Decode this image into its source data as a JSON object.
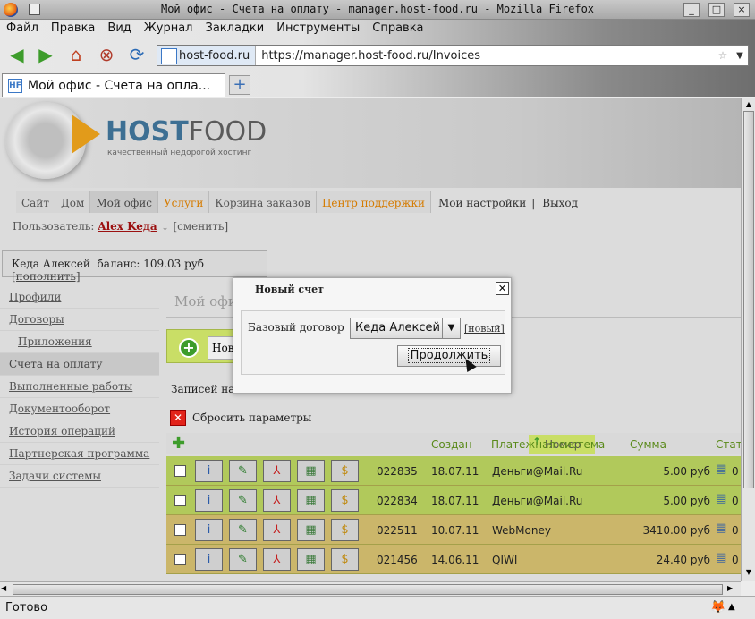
{
  "window": {
    "title": "Мой офис - Счета на оплату - manager.host-food.ru - Mozilla Firefox",
    "btn_min": "_",
    "btn_max": "□",
    "btn_close": "×"
  },
  "menu": [
    "Файл",
    "Правка",
    "Вид",
    "Журнал",
    "Закладки",
    "Инструменты",
    "Справка"
  ],
  "toolbar": {
    "back": "◀",
    "forward": "▶",
    "home": "⌂",
    "stop": "⊗",
    "reload": "⟳"
  },
  "address": {
    "site": "host-food.ru",
    "url": "https://manager.host-food.ru/Invoices",
    "star": "☆",
    "drop": "▼"
  },
  "tab": {
    "label": "Мой офис - Счета на опла...",
    "fav": "HF",
    "new": "+"
  },
  "site": {
    "logo_host": "HOST",
    "logo_food": "FOOD",
    "tagline": "качественный недорогой хостинг"
  },
  "nav": [
    "Сайт",
    "Дом",
    "Мой офис",
    "Услуги",
    "Корзина заказов",
    "Центр поддержки"
  ],
  "nav_plain": [
    "Мои настройки",
    "Выход"
  ],
  "nav_sep": "|",
  "user": {
    "prefix": "Пользователь:",
    "name": "Alex Keда",
    "arrow": "↓",
    "change": "[сменить]"
  },
  "balance": {
    "name": "Кеда Алексей",
    "text": "баланс: 109.03 руб",
    "link": "[пополнить]"
  },
  "sidebar": [
    "Профили",
    "Договоры",
    "Приложения",
    "Счета на оплату",
    "Выполненные работы",
    "Документооборот",
    "История операций",
    "Партнерская программа",
    "Задачи системы"
  ],
  "content": {
    "title": "Мой офис",
    "new_text": "Нов",
    "records": "Записей на",
    "reset": "Сбросить параметры",
    "reset_icon": "✕"
  },
  "table": {
    "plus": "✚",
    "dash": "-",
    "headers": [
      "Номер",
      "Создан",
      "Платежная система",
      "Сумма",
      "Стат"
    ],
    "rows": [
      {
        "num": "022835",
        "date": "18.07.11",
        "system": "Деньги@Mail.Ru",
        "sum": "5.00 руб",
        "st": "0",
        "color": "#b1c95b"
      },
      {
        "num": "022834",
        "date": "18.07.11",
        "system": "Деньги@Mail.Ru",
        "sum": "5.00 руб",
        "st": "0",
        "color": "#b1c95b"
      },
      {
        "num": "022511",
        "date": "10.07.11",
        "system": "WebMoney",
        "sum": "3410.00 руб",
        "st": "0",
        "color": "#cbb66a"
      },
      {
        "num": "021456",
        "date": "14.06.11",
        "system": "QIWI",
        "sum": "24.40 руб",
        "st": "0",
        "color": "#cbb66a"
      }
    ]
  },
  "icons": {
    "info": "i",
    "edit": "✎",
    "pdf": "⅄",
    "img": "▦",
    "pay": "$",
    "st": "▤"
  },
  "modal": {
    "title": "Новый счет",
    "close": "✕",
    "label": "Базовый договор",
    "select": "Кеда Алексей",
    "select_arrow": "▼",
    "new": "[новый]",
    "continue": "Продолжить"
  },
  "scroll": {
    "up": "▲",
    "down": "▼",
    "left": "◀",
    "right": "▶"
  },
  "status": {
    "text": "Готово",
    "fox": "🦊",
    "arrow": "▲"
  }
}
